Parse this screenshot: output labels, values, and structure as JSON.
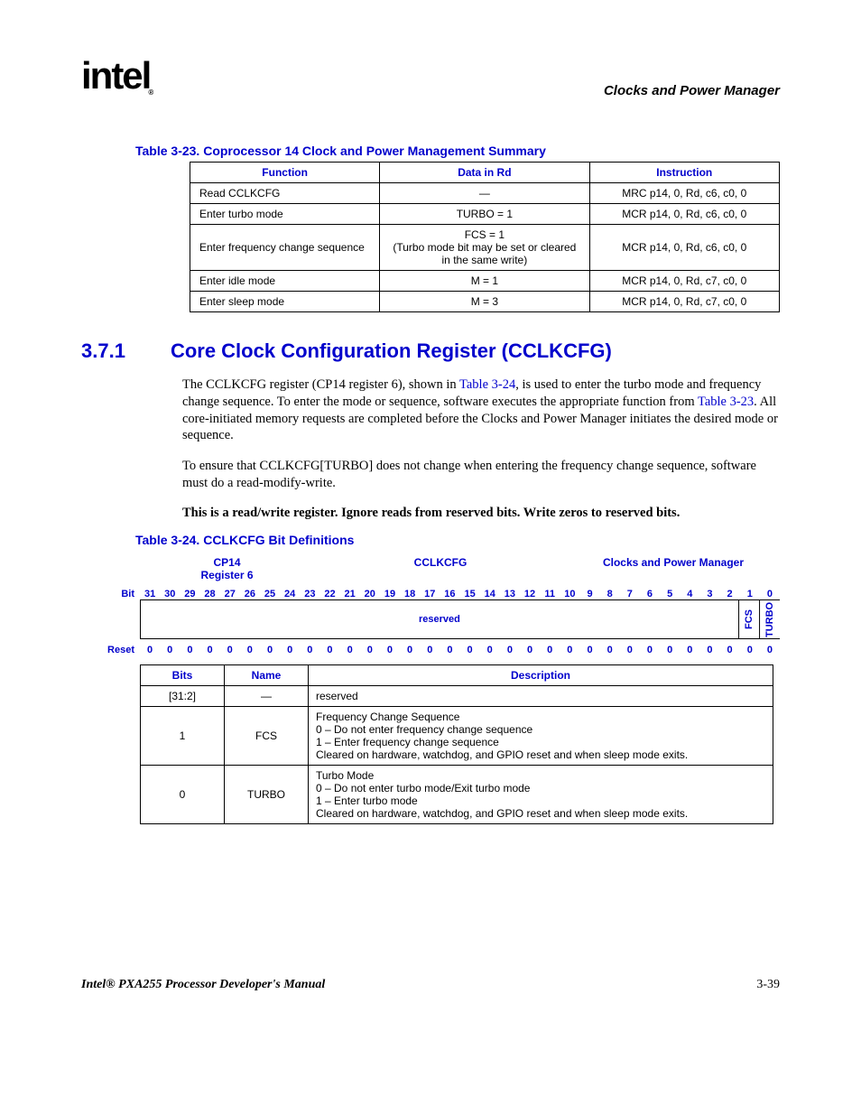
{
  "header": {
    "logo_text": "intel",
    "chapter": "Clocks and Power Manager"
  },
  "table23": {
    "caption": "Table 3-23. Coprocessor 14 Clock and Power Management Summary",
    "headers": [
      "Function",
      "Data in Rd",
      "Instruction"
    ],
    "rows": [
      [
        "Read CCLKCFG",
        "—",
        "MRC p14, 0, Rd, c6, c0, 0"
      ],
      [
        "Enter turbo mode",
        "TURBO = 1",
        "MCR p14, 0, Rd, c6, c0, 0"
      ],
      [
        "Enter frequency change sequence",
        "FCS = 1\n(Turbo mode bit may be set or cleared in the same write)",
        "MCR p14, 0, Rd, c6, c0, 0"
      ],
      [
        "Enter idle mode",
        "M = 1",
        "MCR p14, 0, Rd, c7, c0, 0"
      ],
      [
        "Enter sleep mode",
        "M = 3",
        "MCR p14, 0, Rd, c7, c0, 0"
      ]
    ]
  },
  "section": {
    "number": "3.7.1",
    "title": "Core Clock Configuration Register (CCLKCFG)",
    "para1_a": "The CCLKCFG register (CP14 register 6), shown in ",
    "para1_link1": "Table 3-24",
    "para1_b": ", is used to enter the turbo mode and frequency change sequence. To enter the mode or sequence, software executes the appropriate function from ",
    "para1_link2": "Table 3-23",
    "para1_c": ". All core-initiated memory requests are completed before the Clocks and Power Manager initiates the desired mode or sequence.",
    "para2": "To ensure that CCLKCFG[TURBO] does not change when entering the frequency change sequence, software must do a read-modify-write.",
    "para3": "This is a read/write register. Ignore reads from reserved bits. Write zeros to reserved bits."
  },
  "table24": {
    "caption": "Table 3-24. CCLKCFG Bit Definitions",
    "meta": {
      "left": "CP14\nRegister 6",
      "center": "CCLKCFG",
      "right": "Clocks and Power Manager"
    },
    "bit_label": "Bit",
    "bits": [
      "31",
      "30",
      "29",
      "28",
      "27",
      "26",
      "25",
      "24",
      "23",
      "22",
      "21",
      "20",
      "19",
      "18",
      "17",
      "16",
      "15",
      "14",
      "13",
      "12",
      "11",
      "10",
      "9",
      "8",
      "7",
      "6",
      "5",
      "4",
      "3",
      "2",
      "1",
      "0"
    ],
    "fields": {
      "reserved": "reserved",
      "f1": "FCS",
      "f0": "TURBO"
    },
    "reset_label": "Reset",
    "reset": [
      "0",
      "0",
      "0",
      "0",
      "0",
      "0",
      "0",
      "0",
      "0",
      "0",
      "0",
      "0",
      "0",
      "0",
      "0",
      "0",
      "0",
      "0",
      "0",
      "0",
      "0",
      "0",
      "0",
      "0",
      "0",
      "0",
      "0",
      "0",
      "0",
      "0",
      "0",
      "0"
    ],
    "def_headers": [
      "Bits",
      "Name",
      "Description"
    ],
    "defs": [
      {
        "bits": "[31:2]",
        "name": "—",
        "desc": "reserved"
      },
      {
        "bits": "1",
        "name": "FCS",
        "desc": "Frequency Change Sequence\n0 –  Do not enter frequency change sequence\n1 –  Enter frequency change sequence\nCleared on hardware, watchdog, and GPIO reset and when sleep mode exits."
      },
      {
        "bits": "0",
        "name": "TURBO",
        "desc": "Turbo Mode\n0 –  Do not enter turbo mode/Exit turbo mode\n1 –  Enter turbo mode\nCleared on hardware, watchdog, and GPIO reset and when sleep mode exits."
      }
    ]
  },
  "footer": {
    "title": "Intel® PXA255 Processor Developer's Manual",
    "page": "3-39"
  }
}
